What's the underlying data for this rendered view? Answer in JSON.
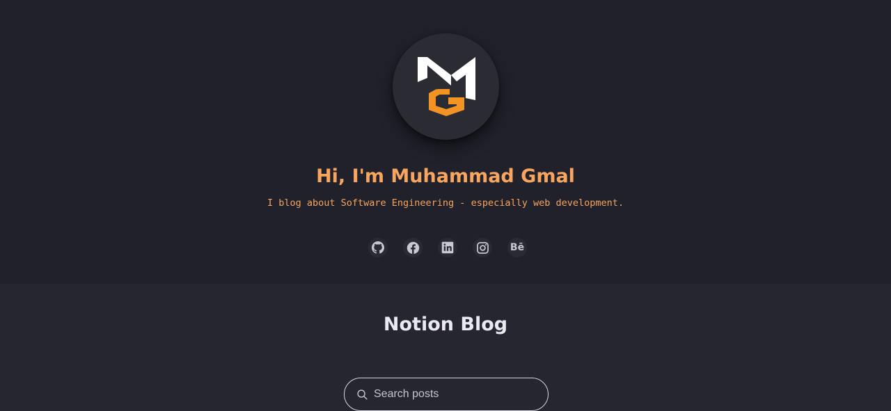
{
  "hero": {
    "title": "Hi, I'm Muhammad Gmal",
    "subtitle": "I blog about Software Engineering - especially web development.",
    "accent_color": "#f7a55f",
    "logo": {
      "icon": "mg-monogram-logo",
      "colors": [
        "#ffffff",
        "#f39323"
      ]
    }
  },
  "social_links": [
    {
      "name": "github",
      "icon": "github-icon"
    },
    {
      "name": "facebook",
      "icon": "facebook-icon"
    },
    {
      "name": "linkedin",
      "icon": "linkedin-icon"
    },
    {
      "name": "instagram",
      "icon": "instagram-icon"
    },
    {
      "name": "behance",
      "icon": "behance-icon",
      "glyph": "Bē"
    }
  ],
  "blog": {
    "title": "Notion Blog",
    "search": {
      "placeholder": "Search posts",
      "value": "",
      "icon": "search-icon"
    }
  }
}
